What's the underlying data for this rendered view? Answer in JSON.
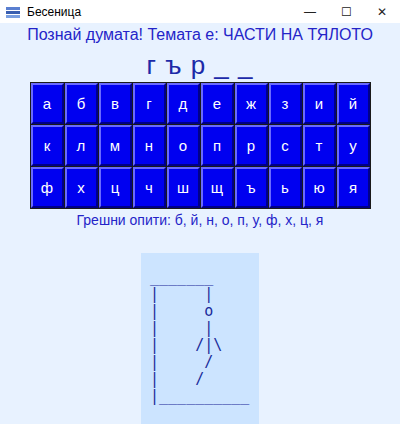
{
  "window": {
    "title": "Бесеница",
    "controls": [
      "—",
      "☐",
      "✕"
    ]
  },
  "heading": "Познай думата! Темата е: ЧАСТИ НА ТЯЛОТО",
  "word": "г ъ р _ _",
  "keyboard": [
    [
      "а",
      "б",
      "в",
      "г",
      "д",
      "е",
      "ж",
      "з",
      "и",
      "й"
    ],
    [
      "к",
      "л",
      "м",
      "н",
      "о",
      "п",
      "р",
      "с",
      "т",
      "у"
    ],
    [
      "ф",
      "х",
      "ц",
      "ч",
      "ш",
      "щ",
      "ъ",
      "ь",
      "ю",
      "я"
    ]
  ],
  "wrong_attempts": "Грешни опити: б, й, н, о, п, у, ф, х, ц, я",
  "gallows": [
    " _______",
    " |     |",
    " |     o",
    " |     |",
    " |    /|\\",
    " |     /",
    " |    /",
    " |__________"
  ]
}
